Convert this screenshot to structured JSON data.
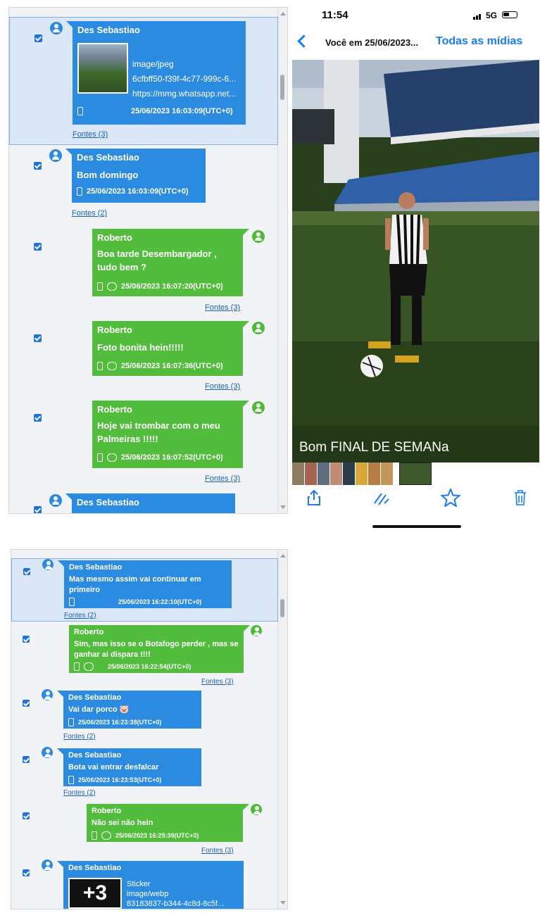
{
  "panel1": {
    "messages": [
      {
        "sender": "Des Sebastiao",
        "lines": [
          "image/jpeg",
          "6cfbff50-f39f-4c77-999c-6...",
          "https://mmg.whatsapp.net..."
        ],
        "timestamp": "25/06/2023 16:03:09(UTC+0)",
        "fontes": "Fontes (3)"
      },
      {
        "sender": "Des Sebastiao",
        "text": "Bom domingo",
        "timestamp": "25/06/2023 16:03:09(UTC+0)",
        "fontes": "Fontes (2)"
      },
      {
        "sender": "Roberto",
        "text": "Boa tarde Desembargador , tudo bem ?",
        "timestamp": "25/06/2023 16:07:20(UTC+0)",
        "fontes": "Fontes (3)"
      },
      {
        "sender": "Roberto",
        "text": "Foto bonita hein!!!!!",
        "timestamp": "25/06/2023 16:07:36(UTC+0)",
        "fontes": "Fontes (3)"
      },
      {
        "sender": "Roberto",
        "text": "Hoje vai trombar com o meu Palmeiras !!!!!",
        "timestamp": "25/06/2023 16:07:52(UTC+0)",
        "fontes": "Fontes (3)"
      },
      {
        "sender": "Des Sebastiao"
      }
    ]
  },
  "phone": {
    "time": "11:54",
    "signal": "5G",
    "nav_title": "Você em 25/06/2023...",
    "nav_action": "Todas as mídias",
    "caption": "Bom FINAL DE SEMANa",
    "icons": [
      "share-icon",
      "markup-icon",
      "star-icon",
      "trash-icon"
    ],
    "accent": "#1a7cf5"
  },
  "panel2": {
    "messages": [
      {
        "sender": "Des Sebastiao",
        "text": "Mas mesmo assim vai continuar em primeiro",
        "timestamp": "25/06/2023 16:22:10(UTC+0)",
        "fontes": "Fontes (2)"
      },
      {
        "sender": "Roberto",
        "text": "Sim, mas isso se o Botafogo perder , mas se ganhar ai dispara !!!!",
        "timestamp": "25/06/2023 16:22:54(UTC+0)",
        "fontes": "Fontes (3)"
      },
      {
        "sender": "Des Sebastiao",
        "text": "Vai dar porco 🐷",
        "timestamp": "25/06/2023 16:23:38(UTC+0)",
        "fontes": "Fontes (2)"
      },
      {
        "sender": "Des Sebastiao",
        "text": "Bota vai entrar desfalcar",
        "timestamp": "25/06/2023 16:23:53(UTC+0)",
        "fontes": "Fontes (2)"
      },
      {
        "sender": "Roberto",
        "text": "Não sei não hein",
        "timestamp": "25/06/2023 16:25:39(UTC+0)",
        "fontes": "Fontes (3)"
      },
      {
        "sender": "Des Sebastiao",
        "lines": [
          "Sticker",
          "image/webp",
          "83183837-b344-4c8d-8c5f..."
        ],
        "sticker_text": "+3"
      }
    ]
  },
  "colors": {
    "blue_bubble": "#2b8be0",
    "green_bubble": "#52bd3c",
    "link": "#1b62b5"
  }
}
